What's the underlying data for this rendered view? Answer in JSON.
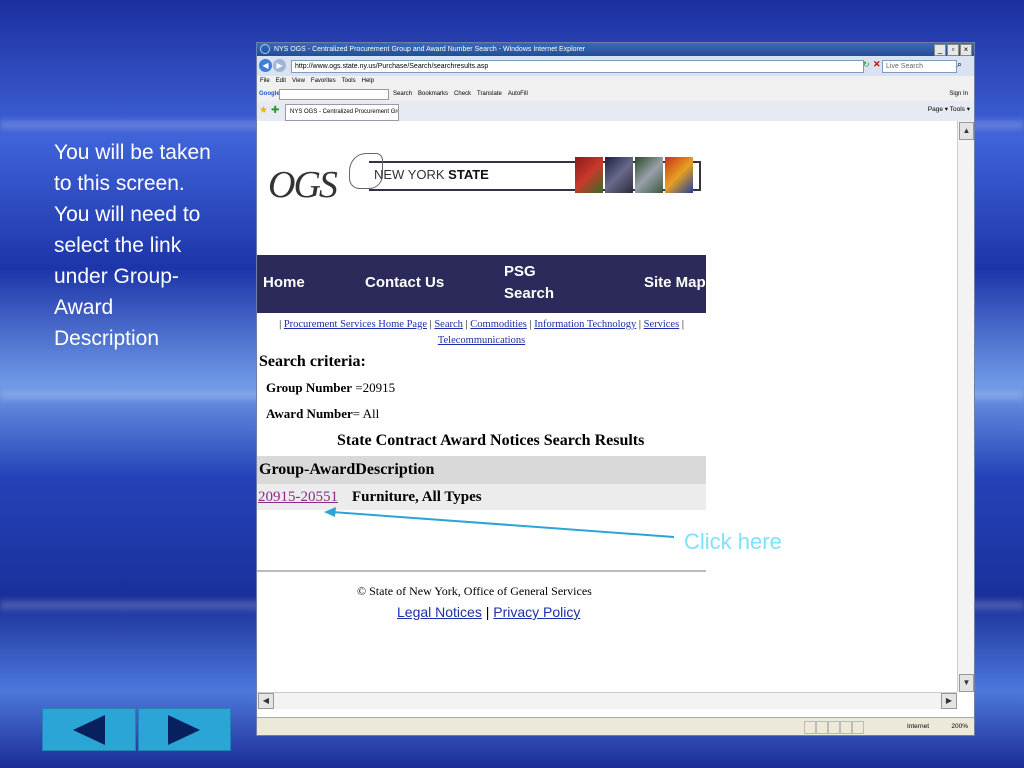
{
  "slide": {
    "instruction": "You will be taken to this screen. You will need to select the link under Group-Award Description",
    "callout": "Click here",
    "arrow_color": "#2aa5d6"
  },
  "browser": {
    "title": "NYS OGS - Centralized Procurement Group and Award Number Search - Windows Internet Explorer",
    "url": "http://www.ogs.state.ny.us/Purchase/Search/searchresults.asp",
    "search_placeholder": "Live Search",
    "menu": [
      "File",
      "Edit",
      "View",
      "Favorites",
      "Tools",
      "Help"
    ],
    "google_items": [
      "Search",
      "Bookmarks",
      "Check",
      "Translate",
      "AutoFill"
    ],
    "google_label": "Google",
    "sign_in": "Sign In",
    "tab_label": "NYS OGS - Centralized Procurement Grou...",
    "tab_tools": "Page ▾  Tools ▾",
    "status_internet": "Internet",
    "status_zoom": "200%"
  },
  "page": {
    "logo_text": "OGS",
    "nys_prefix": "NEW YORK ",
    "nys_bold": "STATE",
    "nav": {
      "home": "Home",
      "contact": "Contact Us",
      "psg_line1": "PSG",
      "psg_line2": "Search",
      "sitemap": "Site Map"
    },
    "links": {
      "l1": "Procurement Services Home Page",
      "l2": "Search",
      "l3": "Commodities",
      "l4": "Information Technology",
      "l5": "Services",
      "l6": "Telecommunications"
    },
    "criteria_title": "Search criteria:",
    "group_label": "Group Number",
    "group_value": " =20915",
    "award_label": "Award Number",
    "award_value": "= All",
    "results_title": "State Contract Award Notices Search Results",
    "col_header": "Group-AwardDescription",
    "row_link": "20915-20551",
    "row_desc": "Furniture, All Types",
    "footer": "© State of New York, Office of General Services",
    "legal": "Legal Notices",
    "privacy": "Privacy Policy"
  }
}
